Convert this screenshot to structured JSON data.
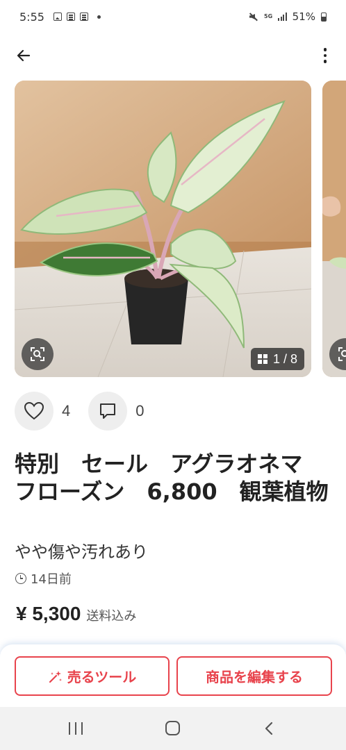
{
  "status_bar": {
    "time": "5:55",
    "network": "5G",
    "battery": "51%",
    "icons": [
      "image-notification-icon",
      "doc-notification-icon",
      "doc-notification-icon",
      "dot-icon",
      "mute-icon",
      "signal-icon",
      "battery-icon"
    ]
  },
  "app_bar": {
    "back_icon": "arrow-left-icon",
    "menu_icon": "more-vertical-icon"
  },
  "gallery": {
    "counter": "1 / 8",
    "current_index": 1,
    "total": 8,
    "zoom_icon": "image-search-icon"
  },
  "engagement": {
    "likes": "4",
    "comments": "0",
    "like_icon": "heart-icon",
    "comment_icon": "comment-icon"
  },
  "item": {
    "title": "特別　セール　アグラオネマ　フローズン　6,800　観葉植物",
    "condition": "やや傷や汚れあり",
    "posted": "14日前",
    "price": "¥ 5,300",
    "shipping": "送料込み"
  },
  "actions": {
    "sell_tools": "売るツール",
    "edit_item": "商品を編集する"
  },
  "colors": {
    "accent": "#e8434c",
    "text": "#222222",
    "nav_bar": "#f2f2f2"
  }
}
